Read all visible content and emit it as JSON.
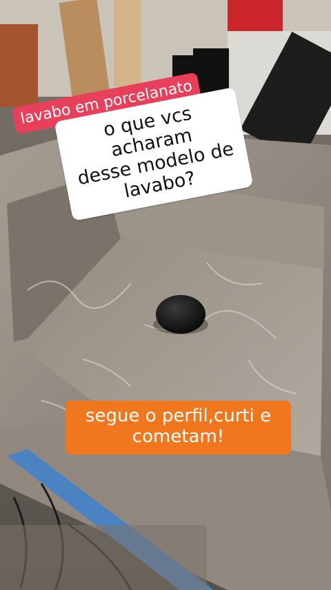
{
  "captions": {
    "tag": "lavabo em porcelanato",
    "question": [
      "o que vcs acharam",
      "desse modelo de",
      "lavabo?"
    ],
    "cta": [
      "segue o perfil,curti e",
      "cometam!"
    ]
  },
  "colors": {
    "tag_bg": "#e8405a",
    "question_bg": "#ffffff",
    "cta_bg": "#f0771e",
    "marble": "#8e857b",
    "faucet": "#111111"
  }
}
